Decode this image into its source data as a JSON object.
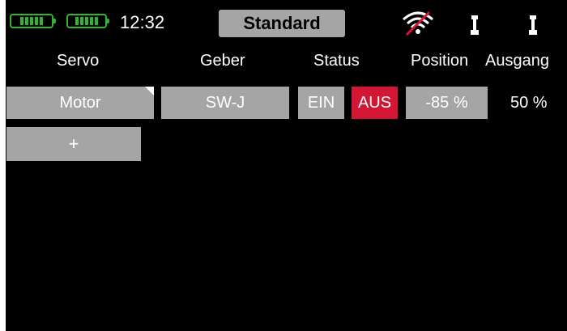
{
  "status_bar": {
    "time": "12:32",
    "profile": "Standard",
    "battery_color": "#2fb52f",
    "battery_1_cells": 5,
    "battery_2_cells": 5,
    "signal_icon": "signal-off-icon",
    "antenna_icon": "antenna-icon"
  },
  "table": {
    "headers": {
      "servo": "Servo",
      "geber": "Geber",
      "status": "Status",
      "position": "Position",
      "ausgang": "Ausgang"
    },
    "rows": [
      {
        "servo": "Motor",
        "geber": "SW-J",
        "status_on": "EIN",
        "status_off": "AUS",
        "position": "-85 %",
        "output": "50 %"
      }
    ],
    "add_label": "+"
  },
  "colors": {
    "background": "#000000",
    "button_gray": "#a5a5a5",
    "active_red": "#d21634",
    "text": "#ffffff"
  }
}
